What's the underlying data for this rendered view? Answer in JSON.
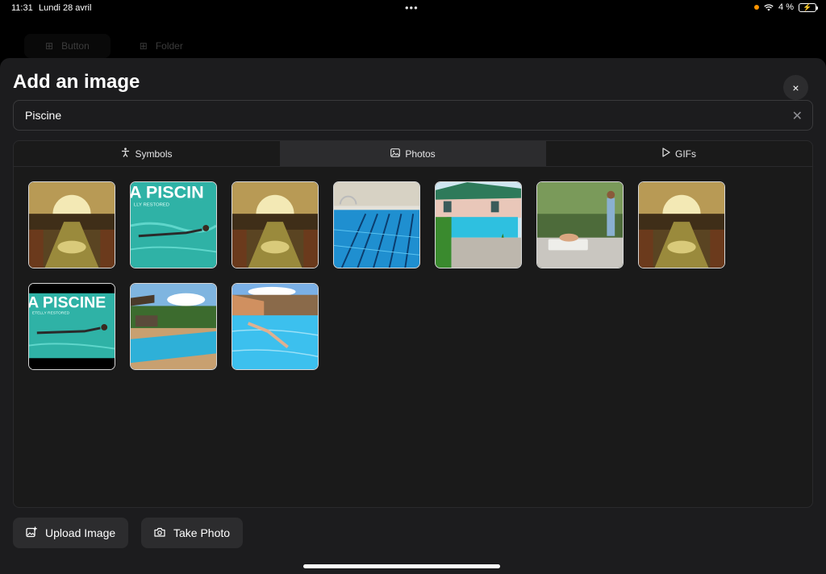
{
  "status": {
    "time": "11:31",
    "date": "Lundi 28 avril",
    "dots": "•••",
    "battery": "4 %"
  },
  "background": {
    "button_label": "Button",
    "folder_label": "Folder"
  },
  "modal": {
    "title": "Add an image",
    "close_symbol": "×",
    "search": {
      "value": "Piscine",
      "clear_symbol": "✕"
    },
    "tabs": [
      {
        "label": "Symbols",
        "icon": "figure-icon",
        "active": false
      },
      {
        "label": "Photos",
        "icon": "photo-icon",
        "active": true
      },
      {
        "label": "GIFs",
        "icon": "play-icon",
        "active": false
      }
    ],
    "results": [
      {
        "subject": "indoor-pool-hall"
      },
      {
        "subject": "swimmer-magazine"
      },
      {
        "subject": "indoor-pool-hall"
      },
      {
        "subject": "lap-pool"
      },
      {
        "subject": "villa-pool"
      },
      {
        "subject": "garden-lounge"
      },
      {
        "subject": "indoor-pool-hall"
      },
      {
        "subject": "swimmer-magazine-letterbox"
      },
      {
        "subject": "resort-pool"
      },
      {
        "subject": "diver-pool"
      }
    ],
    "upload_label": "Upload Image",
    "take_photo_label": "Take Photo"
  },
  "colors": {
    "sheet": "#1c1c1e",
    "pool": "#35c6d8",
    "hall_gold": "#c9a84a"
  }
}
